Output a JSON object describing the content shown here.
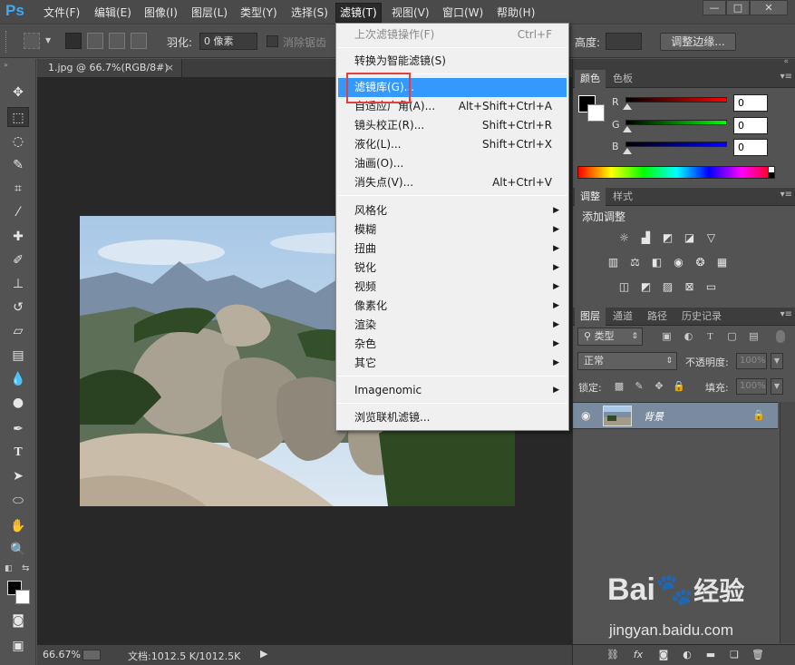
{
  "app": {
    "logo": "Ps",
    "menus": [
      "文件(F)",
      "编辑(E)",
      "图像(I)",
      "图层(L)",
      "类型(Y)",
      "选择(S)",
      "滤镜(T)",
      "视图(V)",
      "窗口(W)",
      "帮助(H)"
    ],
    "active_menu": "滤镜(T)",
    "window_buttons": [
      "—",
      "□",
      "✕"
    ]
  },
  "options": {
    "feather_label": "羽化:",
    "feather_value": "0 像素",
    "antialias_label": "消除锯齿",
    "height_label": "高度:",
    "refine_edge": "调整边缘..."
  },
  "document": {
    "tab_title": "1.jpg @ 66.7%(RGB/8#)",
    "tab_close": "×",
    "zoom": "66.67%",
    "doc_info": "文档:1012.5 K/1012.5K",
    "status_arrow": "▶"
  },
  "filter_menu": {
    "items": [
      {
        "label": "上次滤镜操作(F)",
        "shortcut": "Ctrl+F",
        "disabled": true
      },
      {
        "label": "转换为智能滤镜(S)",
        "shortcut": ""
      },
      {
        "label": "滤镜库(G)...",
        "shortcut": "",
        "hover": true
      },
      {
        "label": "自适应广角(A)...",
        "shortcut": "Alt+Shift+Ctrl+A"
      },
      {
        "label": "镜头校正(R)...",
        "shortcut": "Shift+Ctrl+R"
      },
      {
        "label": "液化(L)...",
        "shortcut": "Shift+Ctrl+X"
      },
      {
        "label": "油画(O)...",
        "shortcut": ""
      },
      {
        "label": "消失点(V)...",
        "shortcut": "Alt+Ctrl+V"
      },
      {
        "label": "风格化",
        "submenu": true
      },
      {
        "label": "模糊",
        "submenu": true
      },
      {
        "label": "扭曲",
        "submenu": true
      },
      {
        "label": "锐化",
        "submenu": true
      },
      {
        "label": "视频",
        "submenu": true
      },
      {
        "label": "像素化",
        "submenu": true
      },
      {
        "label": "渲染",
        "submenu": true
      },
      {
        "label": "杂色",
        "submenu": true
      },
      {
        "label": "其它",
        "submenu": true
      },
      {
        "label": "Imagenomic",
        "submenu": true
      },
      {
        "label": "浏览联机滤镜...",
        "shortcut": ""
      }
    ]
  },
  "color_panel": {
    "tabs": [
      "颜色",
      "色板"
    ],
    "channels": [
      {
        "label": "R",
        "value": "0",
        "color": "#ff0000"
      },
      {
        "label": "G",
        "value": "0",
        "color": "#00ff00"
      },
      {
        "label": "B",
        "value": "0",
        "color": "#0000ff"
      }
    ]
  },
  "adjust_panel": {
    "tabs": [
      "调整",
      "样式"
    ],
    "title": "添加调整"
  },
  "layers_panel": {
    "tabs": [
      "图层",
      "通道",
      "路径",
      "历史记录"
    ],
    "filter": "类型",
    "blend_mode": "正常",
    "opacity_label": "不透明度:",
    "opacity_value": "100%",
    "lock_label": "锁定:",
    "fill_label": "填充:",
    "fill_value": "100%",
    "layer_name": "背景"
  },
  "watermark": {
    "brand": "Bai",
    "brand2": "经验",
    "url": "jingyan.baidu.com"
  }
}
